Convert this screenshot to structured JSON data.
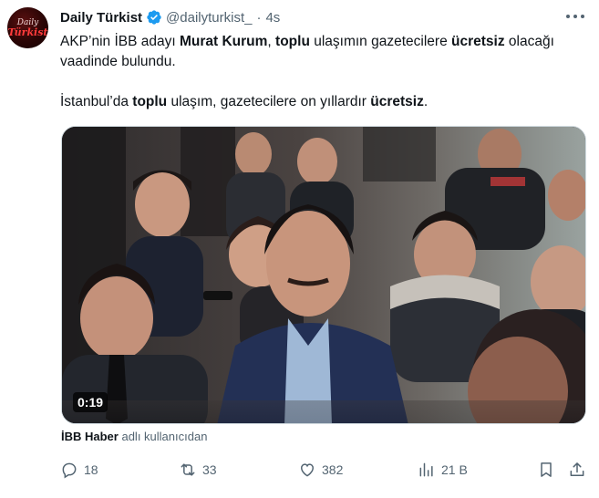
{
  "tweet": {
    "avatar": {
      "line1": "Daily",
      "line2": "Türkist"
    },
    "author_name": "Daily Türkist",
    "handle": "@dailyturkist_",
    "separator": "·",
    "time": "4s",
    "text": {
      "p1_a": "AKP’nin İBB adayı ",
      "p1_b": "Murat Kurum",
      "p1_c": ", ",
      "p1_d": "toplu",
      "p1_e": " ulaşımın gazetecilere ",
      "p1_f": "ücretsiz",
      "p1_g": " olacağı vaadinde bulundu.",
      "p2_a": "İstanbul’da ",
      "p2_b": "toplu",
      "p2_c": " ulaşım, gazetecilere on yıllardır ",
      "p2_d": "ücretsiz",
      "p2_e": "."
    },
    "media": {
      "duration": "0:19"
    },
    "source": {
      "name": "İBB Haber",
      "suffix": " adlı kullanıcıdan"
    },
    "actions": {
      "replies": "18",
      "retweets": "33",
      "likes": "382",
      "views": "21 B"
    },
    "colors": {
      "verified": "#1d9bf0",
      "secondary_text": "#536471",
      "primary_text": "#0f1419"
    }
  }
}
